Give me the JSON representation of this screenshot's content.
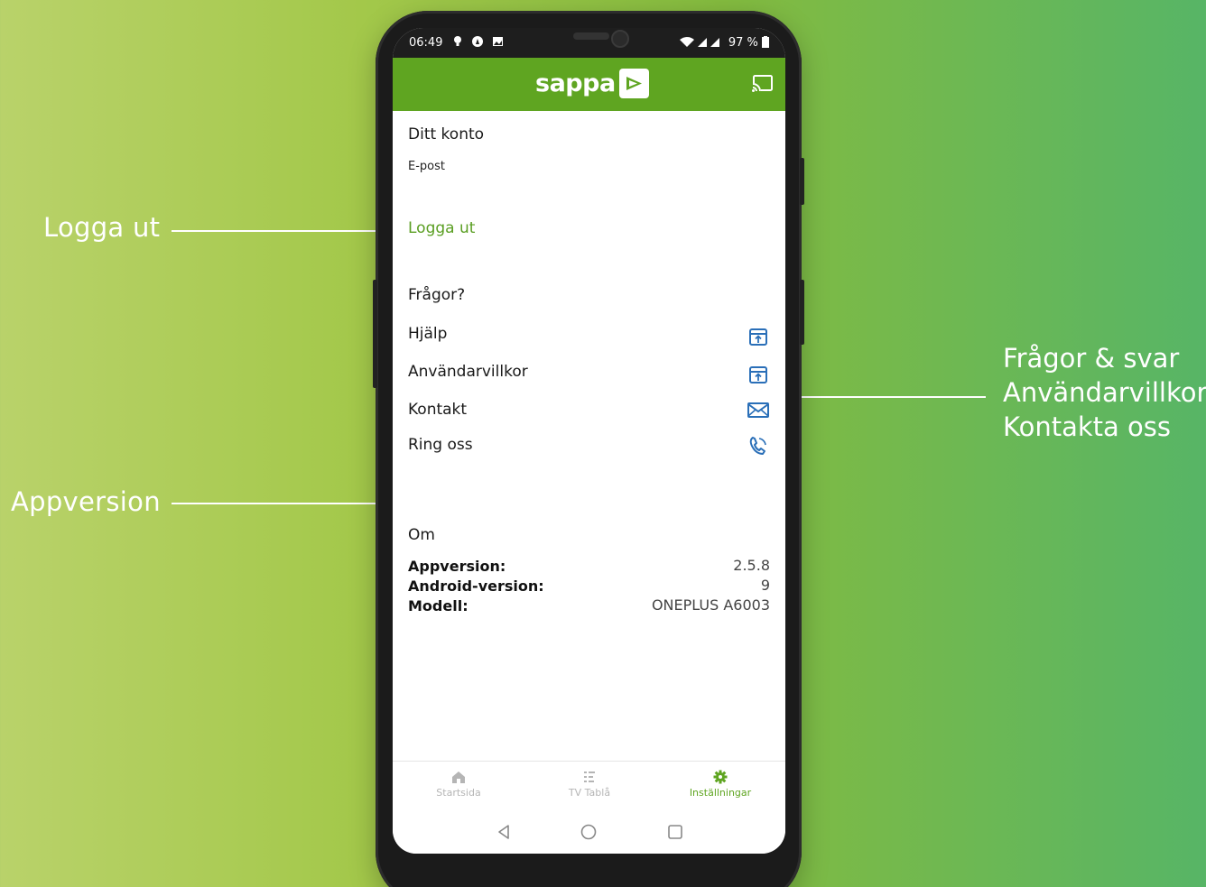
{
  "annotations": {
    "logout": "Logga ut",
    "appversion": "Appversion",
    "right": [
      "Frågor & svar",
      "Användarvillkor",
      "Kontakta oss"
    ]
  },
  "status_bar": {
    "time": "06:49",
    "battery": "97 %"
  },
  "app_bar": {
    "logo_text": "sappa",
    "cast_icon": "cast-icon"
  },
  "account": {
    "title": "Ditt konto",
    "email_label": "E-post",
    "logout": "Logga ut"
  },
  "questions": {
    "title": "Frågor?",
    "items": [
      {
        "label": "Hjälp",
        "icon": "external-link-icon"
      },
      {
        "label": "Användarvillkor",
        "icon": "external-link-icon"
      },
      {
        "label": "Kontakt",
        "icon": "mail-icon"
      },
      {
        "label": "Ring oss",
        "icon": "phone-icon"
      }
    ]
  },
  "about": {
    "title": "Om",
    "rows": [
      {
        "label": "Appversion:",
        "value": "2.5.8"
      },
      {
        "label": "Android-version:",
        "value": "9"
      },
      {
        "label": "Modell:",
        "value": "ONEPLUS A6003"
      }
    ]
  },
  "bottom_nav": [
    {
      "label": "Startsida",
      "icon": "home-icon",
      "active": false
    },
    {
      "label": "TV Tablå",
      "icon": "list-icon",
      "active": false
    },
    {
      "label": "Inställningar",
      "icon": "gear-icon",
      "active": true
    }
  ],
  "colors": {
    "brand_green": "#5fa521",
    "link_green": "#5a9e22",
    "icon_blue": "#2a6fb8"
  }
}
